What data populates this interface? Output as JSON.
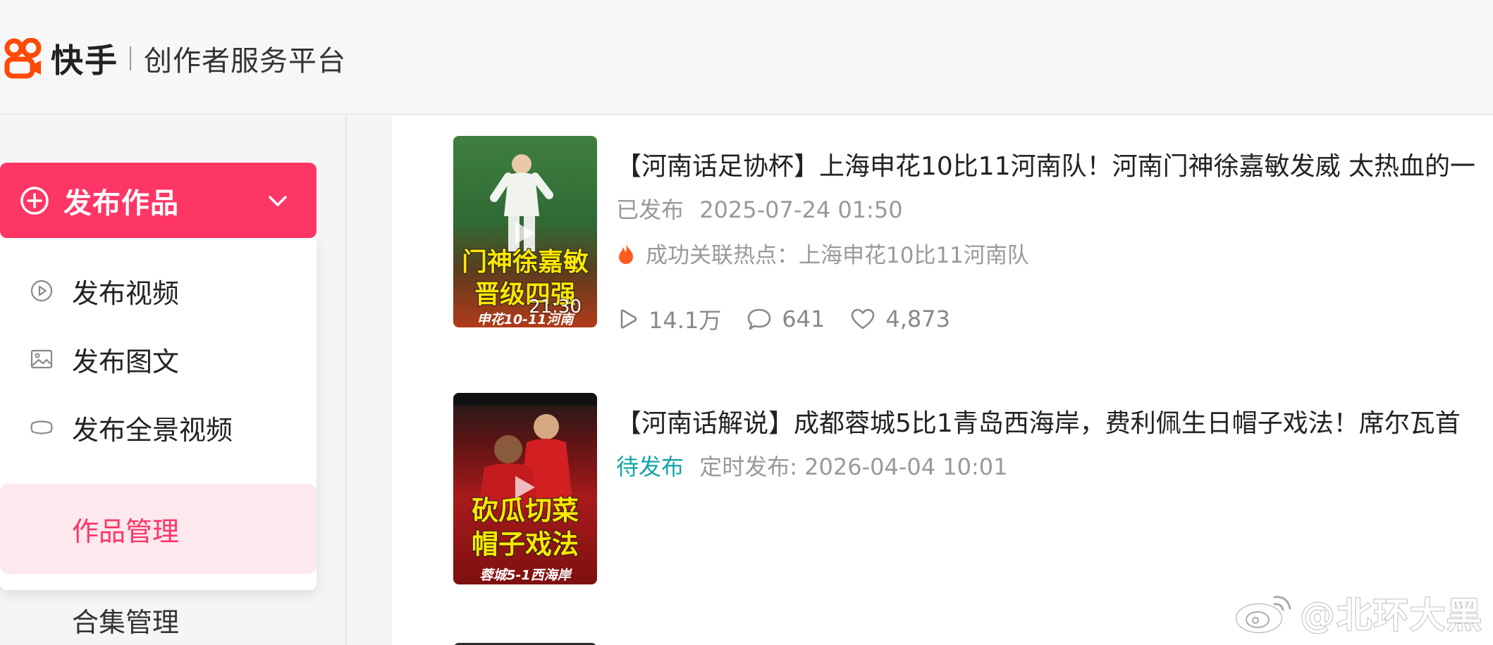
{
  "header": {
    "logo_name": "快手",
    "logo_subtitle": "创作者服务平台"
  },
  "sidebar": {
    "publish_button": "发布作品",
    "publish_menu": [
      {
        "label": "发布视频",
        "icon": "play-circle-icon"
      },
      {
        "label": "发布图文",
        "icon": "image-icon"
      },
      {
        "label": "发布全景视频",
        "icon": "panorama-icon"
      }
    ],
    "nav_active": "作品管理",
    "nav_next": "合集管理"
  },
  "works": [
    {
      "title": "【河南话足协杯】上海申花10比11河南队！河南门神徐嘉敏发威 太热血的一",
      "status": "已发布",
      "publish_time": "2025-07-24 01:50",
      "hot_topic": "成功关联热点：上海申花10比11河南队",
      "duration": "21:30",
      "thumb_caption_1": "门神徐嘉敏",
      "thumb_caption_2": "晋级四强",
      "thumb_caption_3": "申花10-11河南",
      "views": "14.1万",
      "comments": "641",
      "likes": "4,873"
    },
    {
      "title": "【河南话解说】成都蓉城5比1青岛西海岸，费利佩生日帽子戏法！席尔瓦首",
      "status": "待发布",
      "publish_time": "定时发布: 2026-04-04 10:01",
      "thumb_caption_1": "砍瓜切菜",
      "thumb_caption_2": "帽子戏法",
      "thumb_caption_3": "蓉城5-1西海岸"
    }
  ],
  "watermark": "@北环大黑",
  "colors": {
    "brand": "#fe3666",
    "active_bg": "#fde8ed",
    "pending": "#14a5a5",
    "flame": "#ff5a1f"
  }
}
